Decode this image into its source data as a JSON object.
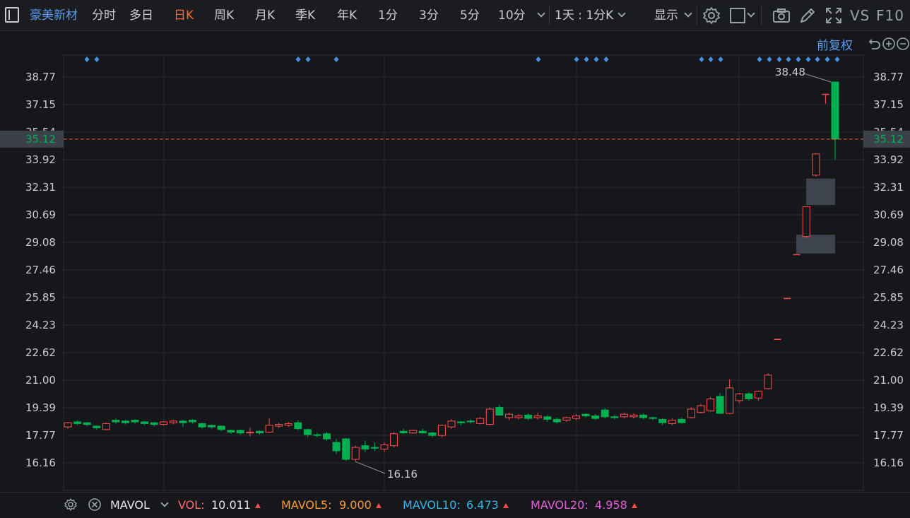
{
  "toolbar": {
    "stock_name": "豪美新材",
    "periods": [
      "分时",
      "多日",
      "日K",
      "周K",
      "月K",
      "季K",
      "年K",
      "1分",
      "3分",
      "5分",
      "10分"
    ],
    "active_period": "日K",
    "interval_label": "1天 : 1分K",
    "display_label": "显示",
    "vs_label": "VS",
    "f10_label": "F10"
  },
  "chart_controls": {
    "adjust_label": "前复权"
  },
  "axis": {
    "price_ticks": [
      "38.77",
      "37.15",
      "35.54",
      "33.92",
      "32.31",
      "30.69",
      "29.08",
      "27.46",
      "25.85",
      "24.23",
      "22.62",
      "21.00",
      "19.39",
      "17.77",
      "16.16"
    ],
    "current_price": "35.12",
    "high_label": "38.48",
    "low_label": "16.16"
  },
  "colors": {
    "up": "#ff4d4f",
    "down": "#00b050",
    "marker": "#4a90e2",
    "current_line": "#ff6a2a",
    "grid": "#26282d"
  },
  "chart_data": {
    "type": "candlestick",
    "ylim": [
      15.5,
      39.3
    ],
    "current_price": 35.12,
    "high": 38.48,
    "low": 16.16,
    "candles": [
      [
        18.2,
        18.45,
        18.1,
        18.5
      ],
      [
        18.5,
        18.4,
        18.3,
        18.6
      ],
      [
        18.45,
        18.35,
        18.25,
        18.5
      ],
      [
        18.25,
        18.15,
        18.05,
        18.3
      ],
      [
        18.05,
        18.4,
        18.0,
        18.45
      ],
      [
        18.6,
        18.5,
        18.4,
        18.7
      ],
      [
        18.55,
        18.45,
        18.35,
        18.6
      ],
      [
        18.6,
        18.5,
        18.4,
        18.65
      ],
      [
        18.5,
        18.4,
        18.3,
        18.55
      ],
      [
        18.45,
        18.35,
        18.25,
        18.5
      ],
      [
        18.35,
        18.5,
        18.3,
        18.55
      ],
      [
        18.45,
        18.55,
        18.35,
        18.6
      ],
      [
        18.55,
        18.45,
        18.2,
        18.6
      ],
      [
        18.6,
        18.5,
        18.4,
        18.65
      ],
      [
        18.4,
        18.2,
        18.1,
        18.45
      ],
      [
        18.3,
        18.2,
        18.1,
        18.35
      ],
      [
        18.25,
        18.05,
        17.95,
        18.3
      ],
      [
        18.0,
        17.9,
        17.8,
        18.05
      ],
      [
        18.0,
        17.85,
        17.75,
        18.05
      ],
      [
        17.85,
        17.9,
        17.65,
        18.15
      ],
      [
        17.95,
        17.85,
        17.75,
        18.0
      ],
      [
        17.9,
        18.3,
        17.85,
        18.7
      ],
      [
        18.25,
        18.35,
        18.15,
        18.45
      ],
      [
        18.3,
        18.4,
        18.2,
        18.5
      ],
      [
        18.45,
        18.1,
        18.0,
        18.6
      ],
      [
        18.05,
        17.75,
        17.6,
        18.1
      ],
      [
        17.75,
        17.7,
        17.6,
        17.85
      ],
      [
        17.8,
        17.5,
        17.4,
        17.9
      ],
      [
        17.3,
        16.8,
        16.6,
        17.5
      ],
      [
        17.5,
        16.3,
        16.2,
        17.55
      ],
      [
        16.3,
        17.0,
        16.16,
        17.1
      ],
      [
        17.1,
        16.9,
        16.7,
        17.4
      ],
      [
        17.0,
        16.95,
        16.8,
        17.3
      ],
      [
        16.9,
        17.15,
        16.75,
        17.3
      ],
      [
        17.1,
        17.8,
        17.0,
        17.9
      ],
      [
        17.95,
        17.85,
        17.8,
        18.1
      ],
      [
        17.85,
        18.0,
        17.8,
        18.05
      ],
      [
        17.95,
        17.85,
        17.8,
        18.1
      ],
      [
        17.85,
        17.7,
        17.6,
        17.9
      ],
      [
        17.7,
        18.3,
        17.6,
        18.35
      ],
      [
        18.2,
        18.55,
        18.1,
        18.65
      ],
      [
        18.5,
        18.45,
        18.3,
        18.55
      ],
      [
        18.55,
        18.5,
        18.4,
        18.65
      ],
      [
        18.4,
        18.7,
        18.35,
        18.8
      ],
      [
        18.35,
        19.25,
        18.3,
        19.35
      ],
      [
        19.35,
        18.9,
        18.85,
        19.5
      ],
      [
        18.75,
        18.95,
        18.6,
        19.05
      ],
      [
        18.75,
        18.85,
        18.65,
        18.95
      ],
      [
        18.9,
        18.7,
        18.6,
        19.0
      ],
      [
        18.75,
        18.85,
        18.65,
        19.05
      ],
      [
        18.8,
        18.65,
        18.5,
        18.9
      ],
      [
        18.65,
        18.5,
        18.4,
        18.75
      ],
      [
        18.6,
        18.75,
        18.5,
        18.8
      ],
      [
        18.7,
        18.85,
        18.6,
        18.95
      ],
      [
        18.95,
        18.85,
        18.75,
        19.0
      ],
      [
        18.85,
        18.7,
        18.6,
        18.95
      ],
      [
        19.2,
        18.8,
        18.7,
        19.3
      ],
      [
        18.8,
        18.75,
        18.65,
        18.9
      ],
      [
        18.8,
        18.95,
        18.7,
        19.05
      ],
      [
        18.8,
        18.9,
        18.7,
        19.0
      ],
      [
        18.9,
        18.75,
        18.65,
        19.0
      ],
      [
        18.75,
        18.7,
        18.6,
        18.8
      ],
      [
        18.65,
        18.45,
        18.3,
        18.7
      ],
      [
        18.4,
        18.6,
        18.3,
        18.7
      ],
      [
        18.65,
        18.45,
        18.4,
        18.75
      ],
      [
        18.75,
        19.25,
        18.7,
        19.35
      ],
      [
        19.05,
        19.45,
        19.0,
        19.55
      ],
      [
        19.15,
        19.85,
        19.1,
        19.95
      ],
      [
        20.0,
        19.0,
        18.95,
        20.2
      ],
      [
        19.0,
        20.5,
        18.95,
        21.0
      ],
      [
        19.75,
        20.15,
        19.6,
        20.2
      ],
      [
        20.15,
        19.85,
        19.75,
        20.25
      ],
      [
        19.9,
        20.3,
        19.75,
        20.35
      ],
      [
        20.45,
        21.25,
        20.4,
        21.35
      ],
      [
        23.35,
        23.35,
        23.35,
        23.35
      ],
      [
        25.75,
        25.75,
        25.75,
        25.75
      ],
      [
        28.33,
        28.33,
        28.33,
        28.33
      ],
      [
        29.4,
        31.15,
        29.3,
        31.15
      ],
      [
        33.0,
        34.25,
        32.9,
        34.3
      ],
      [
        37.75,
        37.75,
        37.2,
        37.75
      ],
      [
        38.48,
        35.12,
        33.92,
        38.48
      ]
    ],
    "gaps": [
      [
        28.4,
        29.5
      ],
      [
        31.25,
        32.8
      ]
    ],
    "signal_markers": [
      [
        0,
        1
      ],
      [
        12,
        13,
        16
      ],
      [
        27,
        30,
        31,
        32,
        33
      ],
      [
        37,
        38,
        39,
        40,
        41,
        42,
        43,
        44,
        45,
        46,
        47,
        48,
        49
      ]
    ],
    "signal_groups_x": [
      [
        123,
        137
      ],
      [
        422,
        436,
        476
      ],
      [
        762,
        816,
        830,
        844,
        858,
        993,
        1006,
        1020
      ],
      [
        1075,
        1089,
        1103,
        1116,
        1130,
        1144,
        1157,
        1171,
        1185
      ]
    ]
  },
  "indicator_bar": {
    "name": "MAVOL",
    "vol_label": "VOL:",
    "vol_value": "10.011",
    "mavol5_label": "MAVOL5:",
    "mavol5_value": "9.000",
    "mavol10_label": "MAVOL10:",
    "mavol10_value": "6.473",
    "mavol20_label": "MAVOL20:",
    "mavol20_value": "4.958"
  }
}
